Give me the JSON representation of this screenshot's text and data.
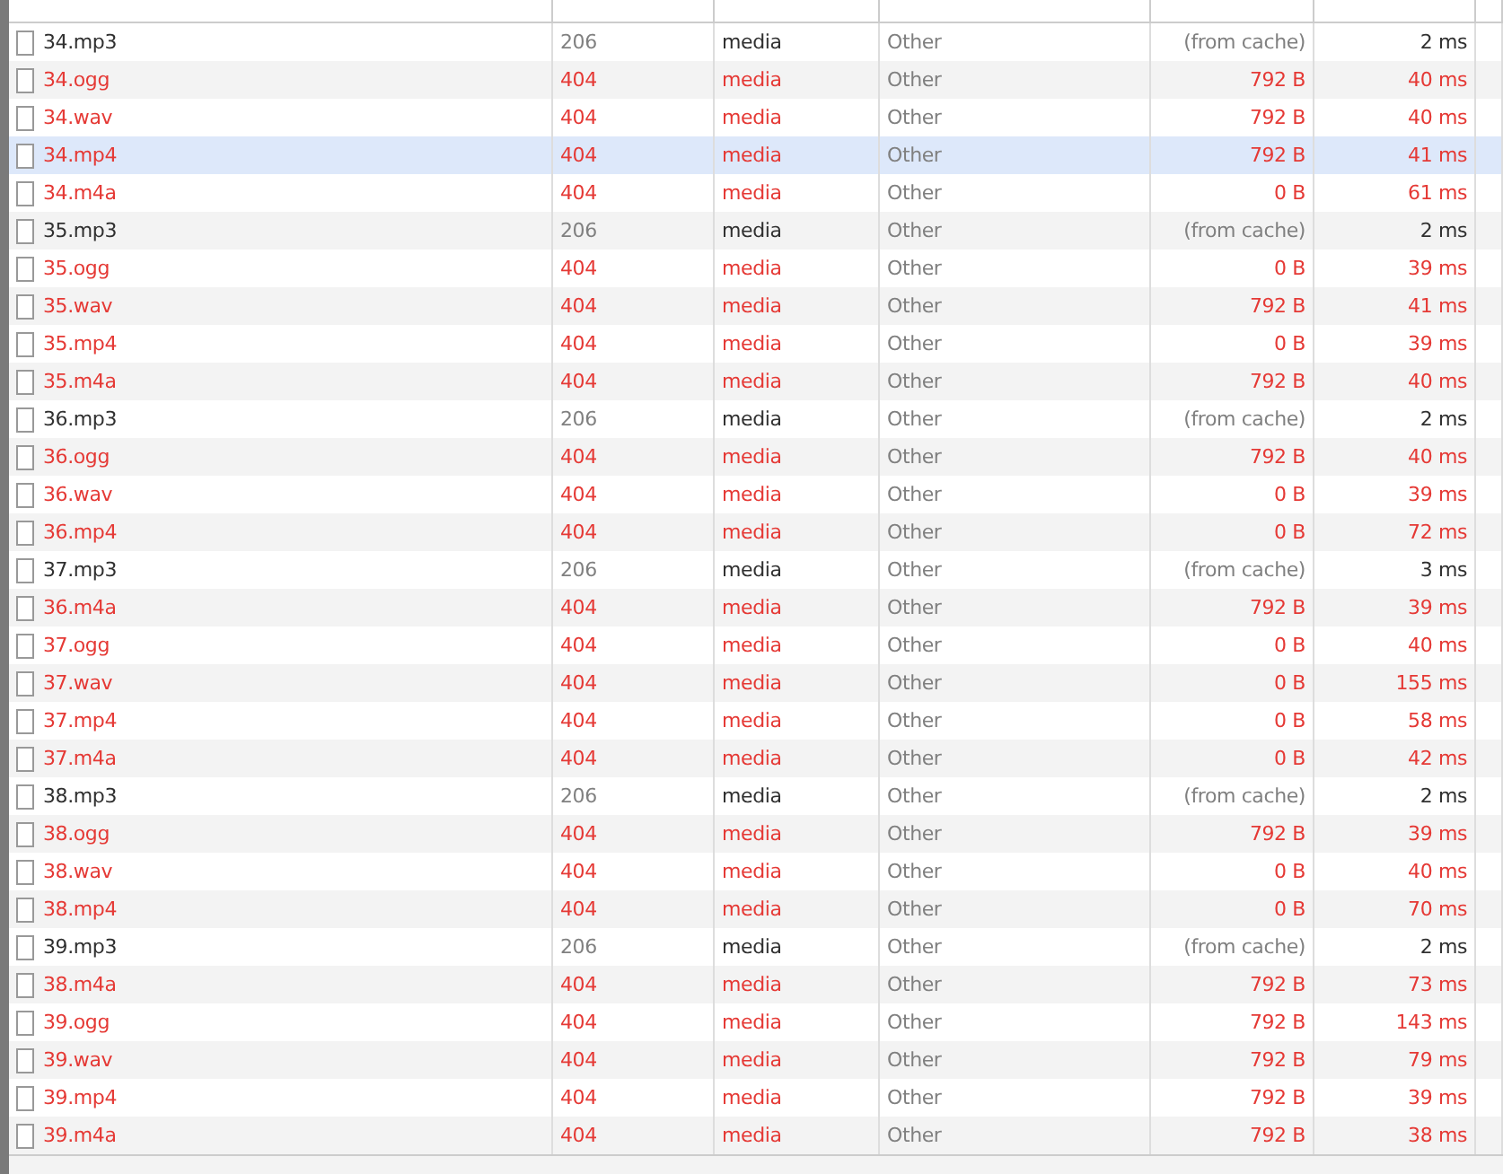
{
  "rows": [
    {
      "name": "34.mp3",
      "status": "206",
      "type": "media",
      "initiator": "Other",
      "size": "(from cache)",
      "time": "2 ms",
      "failed": false,
      "highlighted": false
    },
    {
      "name": "34.ogg",
      "status": "404",
      "type": "media",
      "initiator": "Other",
      "size": "792 B",
      "time": "40 ms",
      "failed": true,
      "highlighted": false
    },
    {
      "name": "34.wav",
      "status": "404",
      "type": "media",
      "initiator": "Other",
      "size": "792 B",
      "time": "40 ms",
      "failed": true,
      "highlighted": false
    },
    {
      "name": "34.mp4",
      "status": "404",
      "type": "media",
      "initiator": "Other",
      "size": "792 B",
      "time": "41 ms",
      "failed": true,
      "highlighted": true
    },
    {
      "name": "34.m4a",
      "status": "404",
      "type": "media",
      "initiator": "Other",
      "size": "0 B",
      "time": "61 ms",
      "failed": true,
      "highlighted": false
    },
    {
      "name": "35.mp3",
      "status": "206",
      "type": "media",
      "initiator": "Other",
      "size": "(from cache)",
      "time": "2 ms",
      "failed": false,
      "highlighted": false
    },
    {
      "name": "35.ogg",
      "status": "404",
      "type": "media",
      "initiator": "Other",
      "size": "0 B",
      "time": "39 ms",
      "failed": true,
      "highlighted": false
    },
    {
      "name": "35.wav",
      "status": "404",
      "type": "media",
      "initiator": "Other",
      "size": "792 B",
      "time": "41 ms",
      "failed": true,
      "highlighted": false
    },
    {
      "name": "35.mp4",
      "status": "404",
      "type": "media",
      "initiator": "Other",
      "size": "0 B",
      "time": "39 ms",
      "failed": true,
      "highlighted": false
    },
    {
      "name": "35.m4a",
      "status": "404",
      "type": "media",
      "initiator": "Other",
      "size": "792 B",
      "time": "40 ms",
      "failed": true,
      "highlighted": false
    },
    {
      "name": "36.mp3",
      "status": "206",
      "type": "media",
      "initiator": "Other",
      "size": "(from cache)",
      "time": "2 ms",
      "failed": false,
      "highlighted": false
    },
    {
      "name": "36.ogg",
      "status": "404",
      "type": "media",
      "initiator": "Other",
      "size": "792 B",
      "time": "40 ms",
      "failed": true,
      "highlighted": false
    },
    {
      "name": "36.wav",
      "status": "404",
      "type": "media",
      "initiator": "Other",
      "size": "0 B",
      "time": "39 ms",
      "failed": true,
      "highlighted": false
    },
    {
      "name": "36.mp4",
      "status": "404",
      "type": "media",
      "initiator": "Other",
      "size": "0 B",
      "time": "72 ms",
      "failed": true,
      "highlighted": false
    },
    {
      "name": "37.mp3",
      "status": "206",
      "type": "media",
      "initiator": "Other",
      "size": "(from cache)",
      "time": "3 ms",
      "failed": false,
      "highlighted": false
    },
    {
      "name": "36.m4a",
      "status": "404",
      "type": "media",
      "initiator": "Other",
      "size": "792 B",
      "time": "39 ms",
      "failed": true,
      "highlighted": false
    },
    {
      "name": "37.ogg",
      "status": "404",
      "type": "media",
      "initiator": "Other",
      "size": "0 B",
      "time": "40 ms",
      "failed": true,
      "highlighted": false
    },
    {
      "name": "37.wav",
      "status": "404",
      "type": "media",
      "initiator": "Other",
      "size": "0 B",
      "time": "155 ms",
      "failed": true,
      "highlighted": false
    },
    {
      "name": "37.mp4",
      "status": "404",
      "type": "media",
      "initiator": "Other",
      "size": "0 B",
      "time": "58 ms",
      "failed": true,
      "highlighted": false
    },
    {
      "name": "37.m4a",
      "status": "404",
      "type": "media",
      "initiator": "Other",
      "size": "0 B",
      "time": "42 ms",
      "failed": true,
      "highlighted": false
    },
    {
      "name": "38.mp3",
      "status": "206",
      "type": "media",
      "initiator": "Other",
      "size": "(from cache)",
      "time": "2 ms",
      "failed": false,
      "highlighted": false
    },
    {
      "name": "38.ogg",
      "status": "404",
      "type": "media",
      "initiator": "Other",
      "size": "792 B",
      "time": "39 ms",
      "failed": true,
      "highlighted": false
    },
    {
      "name": "38.wav",
      "status": "404",
      "type": "media",
      "initiator": "Other",
      "size": "0 B",
      "time": "40 ms",
      "failed": true,
      "highlighted": false
    },
    {
      "name": "38.mp4",
      "status": "404",
      "type": "media",
      "initiator": "Other",
      "size": "0 B",
      "time": "70 ms",
      "failed": true,
      "highlighted": false
    },
    {
      "name": "39.mp3",
      "status": "206",
      "type": "media",
      "initiator": "Other",
      "size": "(from cache)",
      "time": "2 ms",
      "failed": false,
      "highlighted": false
    },
    {
      "name": "38.m4a",
      "status": "404",
      "type": "media",
      "initiator": "Other",
      "size": "792 B",
      "time": "73 ms",
      "failed": true,
      "highlighted": false
    },
    {
      "name": "39.ogg",
      "status": "404",
      "type": "media",
      "initiator": "Other",
      "size": "792 B",
      "time": "143 ms",
      "failed": true,
      "highlighted": false
    },
    {
      "name": "39.wav",
      "status": "404",
      "type": "media",
      "initiator": "Other",
      "size": "792 B",
      "time": "79 ms",
      "failed": true,
      "highlighted": false
    },
    {
      "name": "39.mp4",
      "status": "404",
      "type": "media",
      "initiator": "Other",
      "size": "792 B",
      "time": "39 ms",
      "failed": true,
      "highlighted": false
    },
    {
      "name": "39.m4a",
      "status": "404",
      "type": "media",
      "initiator": "Other",
      "size": "792 B",
      "time": "38 ms",
      "failed": true,
      "highlighted": false
    }
  ]
}
